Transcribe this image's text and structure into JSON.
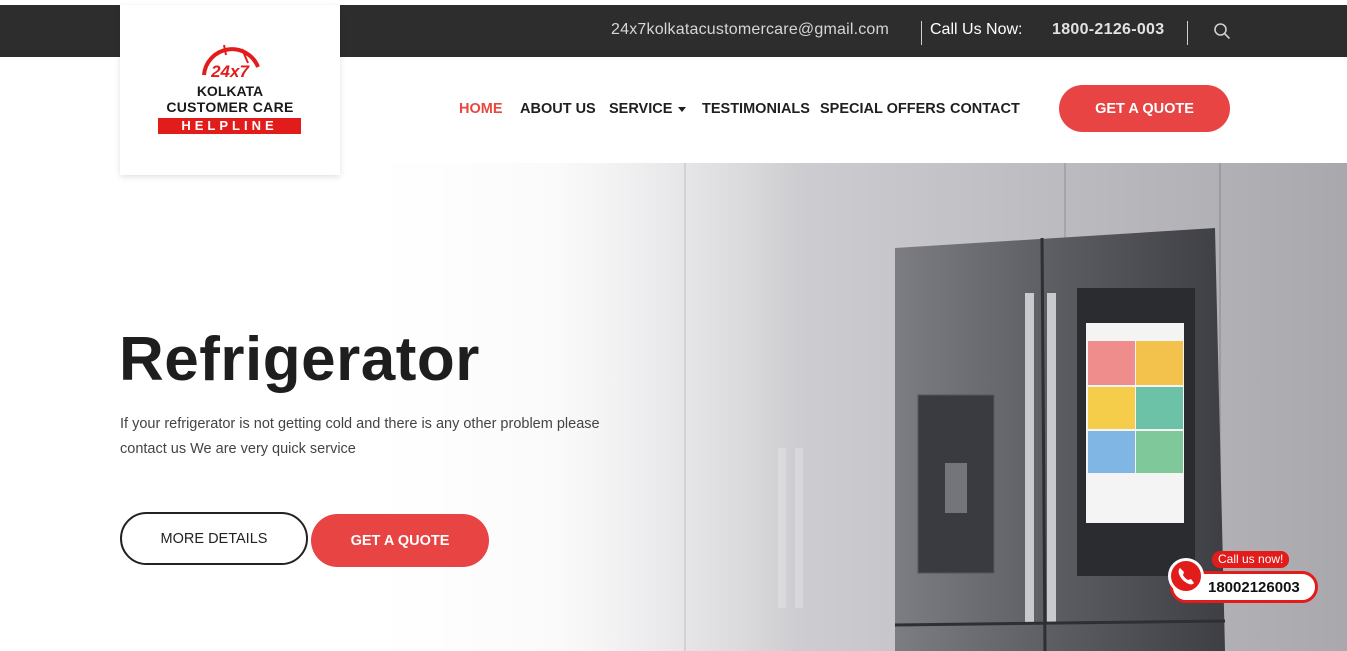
{
  "topbar": {
    "email": "24x7kolkatacustomercare@gmail.com",
    "call_label": "Call Us Now:",
    "phone": "1800-2126-003",
    "search_icon": "search-icon"
  },
  "logo": {
    "badge": "24x7",
    "line1": "KOLKATA",
    "line2": "CUSTOMER CARE",
    "line3": "HELPLINE"
  },
  "nav": {
    "items": [
      {
        "label": "HOME",
        "active": true
      },
      {
        "label": "ABOUT US"
      },
      {
        "label": "SERVICE",
        "dropdown": true
      },
      {
        "label": "TESTIMONIALS"
      },
      {
        "label": "SPECIAL OFFERS"
      },
      {
        "label": "CONTACT"
      }
    ],
    "quote_button": "GET A QUOTE"
  },
  "hero": {
    "title": "Refrigerator",
    "description": "If your refrigerator is not getting cold and there is any other problem please contact us We are very quick service",
    "more_button": "MORE DETAILS",
    "quote_button": "GET A QUOTE"
  },
  "call_widget": {
    "tag": "Call us now!",
    "number": "18002126003",
    "icon": "phone-icon"
  },
  "colors": {
    "accent": "#e84444",
    "brand_red": "#e21b1b",
    "topbar_bg": "#2d2d2d"
  }
}
